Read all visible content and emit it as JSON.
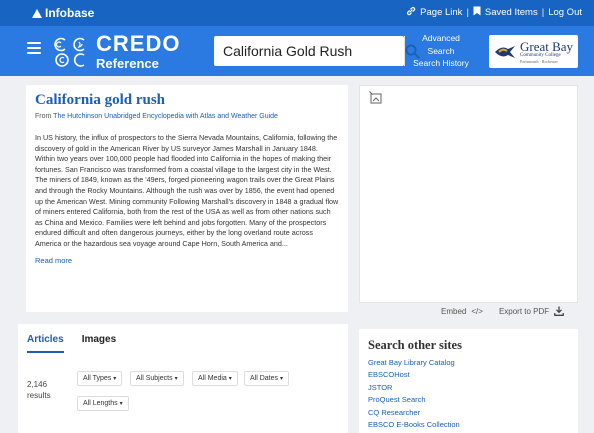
{
  "topbar": {
    "brand": "Infobase",
    "page_link": "Page Link",
    "saved_items": "Saved Items",
    "separator": "|",
    "log_out": "Log Out"
  },
  "header": {
    "logo_title": "CREDO",
    "logo_subtitle": "Reference",
    "search": {
      "value": "California Gold Rush",
      "placeholder": ""
    },
    "advanced_search": [
      "Advanced",
      "Search"
    ],
    "search_history": "Search History",
    "institution": {
      "name": "Great Bay",
      "line2": "Community College",
      "line3": "Portsmouth · Rochester"
    }
  },
  "article": {
    "title": "California gold rush",
    "source_prefix": "From",
    "source": "The Hutchinson Unabridged Encyclopedia with Atlas and Weather Guide",
    "body": "In US history, the influx of prospectors to the Sierra Nevada Mountains, California, following the discovery of gold in the American River by US surveyor James Marshall in January 1848. Within two years over 100,000 people had flooded into California in the hopes of making their fortunes. San Francisco was transformed from a coastal village to the largest city in the West. The miners of 1849, known as the '49ers, forged pioneering wagon trails over the Great Plains and through the Rocky Mountains. Although the rush was over by 1856, the event had opened up the American West. Mining community Following Marshall's discovery in 1848 a gradual flow of miners entered California, both from the rest of the USA as well as from other nations such as China and Mexico. Families were left behind and jobs forgotten. Many of the prospectors endured difficult and often dangerous journeys, either by the long overland route across America or the hazardous sea voyage around Cape Horn, South America and...",
    "read_more": "Read more"
  },
  "media": {
    "embed_label": "Embed",
    "embed_glyph": "</>",
    "export_label": "Export to PDF"
  },
  "results": {
    "tabs": [
      "Articles",
      "Images"
    ],
    "count": "2,146",
    "count_label": "results",
    "filters": [
      "All Types",
      "All Subjects",
      "All Media",
      "All Dates",
      "All Lengths"
    ]
  },
  "other_sites": {
    "title": "Search other sites",
    "links": [
      "Great Bay Library Catalog",
      "EBSCOHost",
      "JSTOR",
      "ProQuest Search",
      "CQ Researcher",
      "EBSCO E-Books Collection"
    ]
  },
  "colors": {
    "topbar": "#1864c3",
    "header": "#2a7ae2",
    "link": "#1a5fb4",
    "page_background": "#eef0f3"
  },
  "icons": [
    "menu-icon",
    "credo-logo-icon",
    "search-icon",
    "link-icon",
    "bookmark-icon",
    "broken-image-icon",
    "code-icon",
    "download-icon",
    "infobase-logo-icon",
    "great-bay-logo-icon"
  ]
}
